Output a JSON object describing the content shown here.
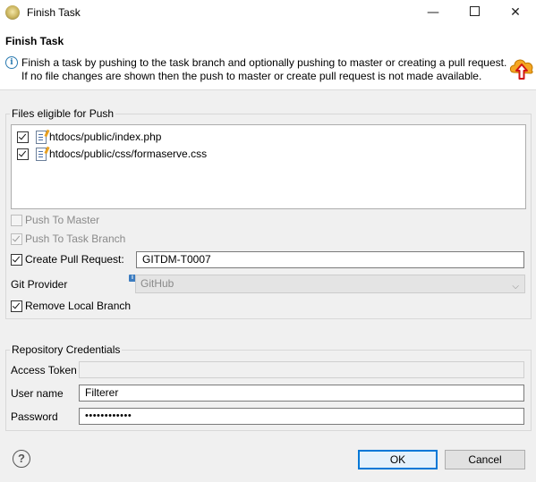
{
  "window": {
    "title": "Finish Task",
    "minimize_glyph": "—",
    "close_glyph": "✕"
  },
  "header": {
    "title": "Finish Task",
    "info_line1": "Finish a task by pushing to the task branch and optionally pushing to master or creating a pull request.",
    "info_line2": "If no file changes are shown then the push to master or create pull request is not made available.",
    "info_icon": "info-icon",
    "banner_icon": "cloud-upload-icon"
  },
  "files_group": {
    "label": "Files eligible for Push",
    "files": [
      {
        "path": "htdocs/public/index.php",
        "checked": true
      },
      {
        "path": "htdocs/public/css/formaserve.css",
        "checked": true
      }
    ]
  },
  "options": {
    "push_to_master": {
      "label": "Push To Master",
      "checked": false,
      "enabled": false
    },
    "push_to_task_branch": {
      "label": "Push To Task Branch",
      "checked": true,
      "enabled": false
    },
    "create_pull_request": {
      "label": "Create Pull Request:",
      "checked": true,
      "value": "GITDM-T0007"
    },
    "git_provider": {
      "label": "Git Provider",
      "value": "GitHub",
      "enabled": false
    },
    "remove_local_branch": {
      "label": "Remove Local Branch",
      "checked": true
    }
  },
  "credentials": {
    "label": "Repository Credentials",
    "access_token": {
      "label": "Access Token",
      "value": ""
    },
    "user_name": {
      "label": "User name",
      "value": "Filterer"
    },
    "password": {
      "label": "Password",
      "value": "••••••••••••"
    }
  },
  "buttons": {
    "help": "?",
    "ok": "OK",
    "cancel": "Cancel"
  },
  "colors": {
    "accent": "#0078d7",
    "info": "#2a7ab0",
    "upload_arrow": "#d01515",
    "upload_cloud": "#f5a623"
  }
}
